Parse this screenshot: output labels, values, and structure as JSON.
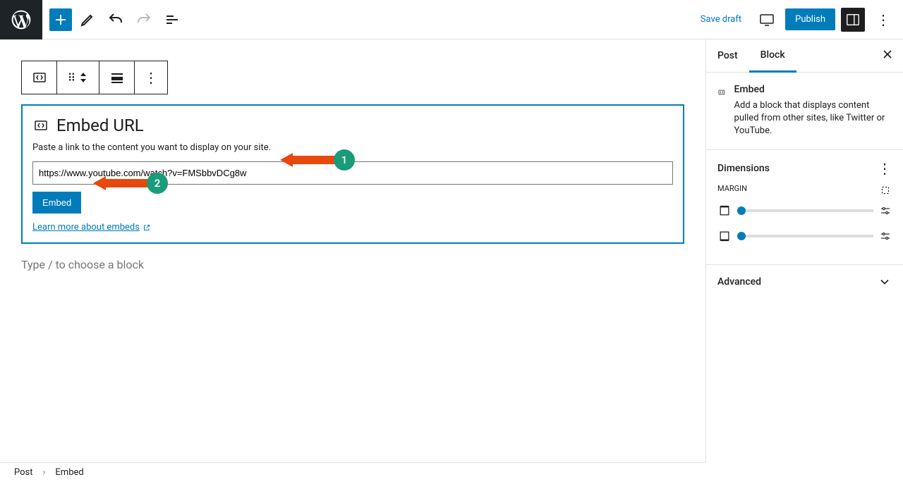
{
  "topbar": {
    "save_draft": "Save draft",
    "publish": "Publish"
  },
  "block_toolbar": {},
  "embed": {
    "title": "Embed URL",
    "description": "Paste a link to the content you want to display on your site.",
    "url_value": "https://www.youtube.com/watch?v=FMSbbvDCg8w",
    "button": "Embed",
    "learn_more": "Learn more about embeds"
  },
  "editor": {
    "placeholder": "Type / to choose a block"
  },
  "sidebar": {
    "tabs": {
      "post": "Post",
      "block": "Block"
    },
    "block_info": {
      "title": "Embed",
      "desc": "Add a block that displays content pulled from other sites, like Twitter or YouTube."
    },
    "dimensions": {
      "title": "Dimensions",
      "margin_label": "MARGIN"
    },
    "advanced": "Advanced"
  },
  "breadcrumb": {
    "post": "Post",
    "embed": "Embed"
  },
  "callouts": {
    "one": "1",
    "two": "2"
  }
}
